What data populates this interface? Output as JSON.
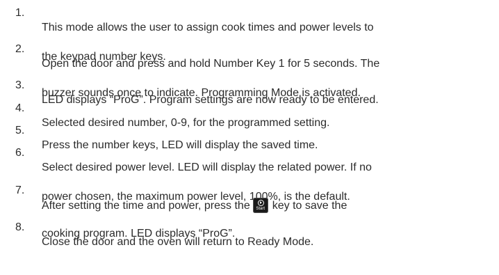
{
  "steps": [
    {
      "number": "1.",
      "lines": [
        "This mode allows the user to assign cook times and power levels to",
        "the keypad number keys."
      ]
    },
    {
      "number": "2.",
      "lines": [
        "Open the door and press and hold Number Key 1 for 5 seconds. The",
        "buzzer sounds once to indicate. Programming Mode is activated."
      ]
    },
    {
      "number": "3.",
      "lines": [
        "LED displays “ProG”. Program settings are now ready to be entered."
      ]
    },
    {
      "number": "4.",
      "lines": [
        "Selected desired number, 0-9, for the programmed setting."
      ]
    },
    {
      "number": "5.",
      "lines": [
        "Press the number keys, LED will display the saved time."
      ]
    },
    {
      "number": "6.",
      "lines": [
        "Select desired power level. LED will display the related power. If no",
        "power chosen, the maximum power level, 100%, is the default."
      ]
    },
    {
      "number": "7.",
      "line1_before": "After setting the time and power, press the",
      "line1_after": "key to save the",
      "line2": "cooking program. LED displays “ProG”.",
      "key_label": "Start",
      "key_icon": "start-play-icon"
    },
    {
      "number": "8.",
      "lines": [
        "Close the door and the oven will return to Ready Mode."
      ]
    }
  ]
}
